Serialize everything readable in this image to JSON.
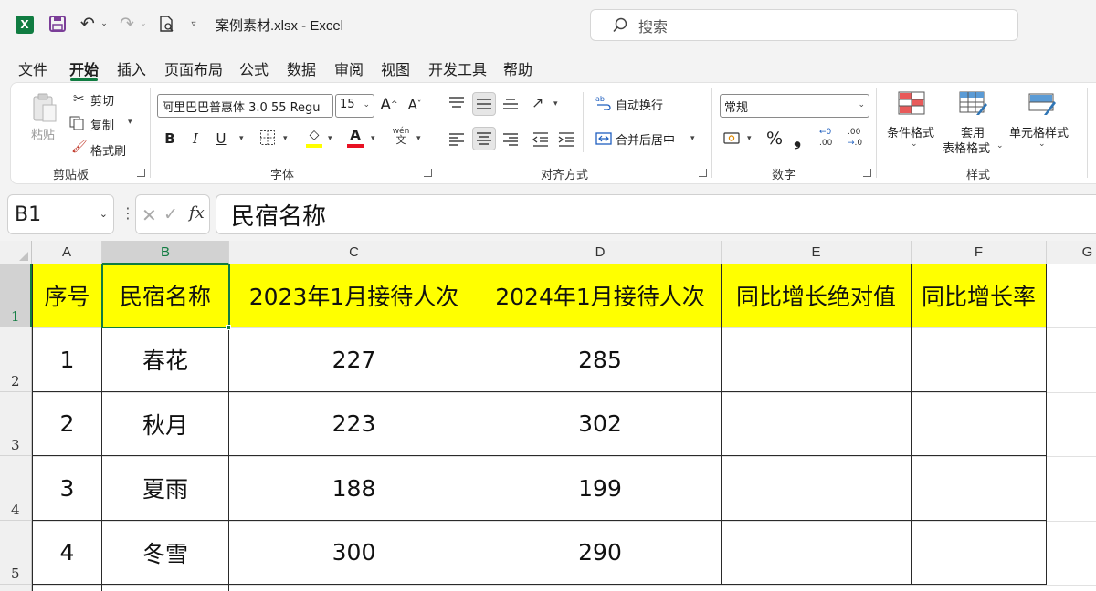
{
  "window": {
    "logo": "X",
    "title": "案例素材.xlsx  -  Excel",
    "search_placeholder": "搜索"
  },
  "menu": {
    "tabs": [
      "文件",
      "开始",
      "插入",
      "页面布局",
      "公式",
      "数据",
      "审阅",
      "视图",
      "开发工具",
      "帮助"
    ],
    "active": "开始"
  },
  "ribbon": {
    "clipboard": {
      "paste": "粘贴",
      "cut": "剪切",
      "copy": "复制",
      "format_painter": "格式刷",
      "label": "剪贴板"
    },
    "font": {
      "name": "阿里巴巴普惠体 3.0 55 Regu",
      "size": "15",
      "grow": "A",
      "shrink": "A",
      "bold": "B",
      "italic": "I",
      "underline": "U",
      "fill_glyph": "◇",
      "color_glyph": "A",
      "phonetic_top": "wén",
      "phonetic_bottom": "文",
      "label": "字体"
    },
    "alignment": {
      "wrap": "自动换行",
      "merge": "合并后居中",
      "label": "对齐方式"
    },
    "number": {
      "format": "常规",
      "percent": "%",
      "comma": "❟",
      "inc_decimal": ".00",
      "dec_decimal": ".0",
      "label": "数字"
    },
    "styles": {
      "conditional": "条件格式",
      "table_line1": "套用",
      "table_line2": "表格格式",
      "cell_styles": "单元格样式",
      "label": "样式"
    },
    "colors": {
      "fill": "#ffff00",
      "font": "#e81123",
      "accent": "#107c41"
    }
  },
  "formula_bar": {
    "name_box": "B1",
    "content": "民宿名称"
  },
  "sheet": {
    "columns": [
      "A",
      "B",
      "C",
      "D",
      "E",
      "F",
      "G"
    ],
    "rows": [
      "1",
      "2",
      "3",
      "4",
      "5"
    ],
    "selected_cell": "B1",
    "header_fill": "#ffff00",
    "headers": [
      "序号",
      "民宿名称",
      "2023年1月接待人次",
      "2024年1月接待人次",
      "同比增长绝对值",
      "同比增长率"
    ],
    "data": [
      [
        "1",
        "春花",
        "227",
        "285",
        "",
        ""
      ],
      [
        "2",
        "秋月",
        "223",
        "302",
        "",
        ""
      ],
      [
        "3",
        "夏雨",
        "188",
        "199",
        "",
        ""
      ],
      [
        "4",
        "冬雪",
        "300",
        "290",
        "",
        ""
      ]
    ]
  }
}
